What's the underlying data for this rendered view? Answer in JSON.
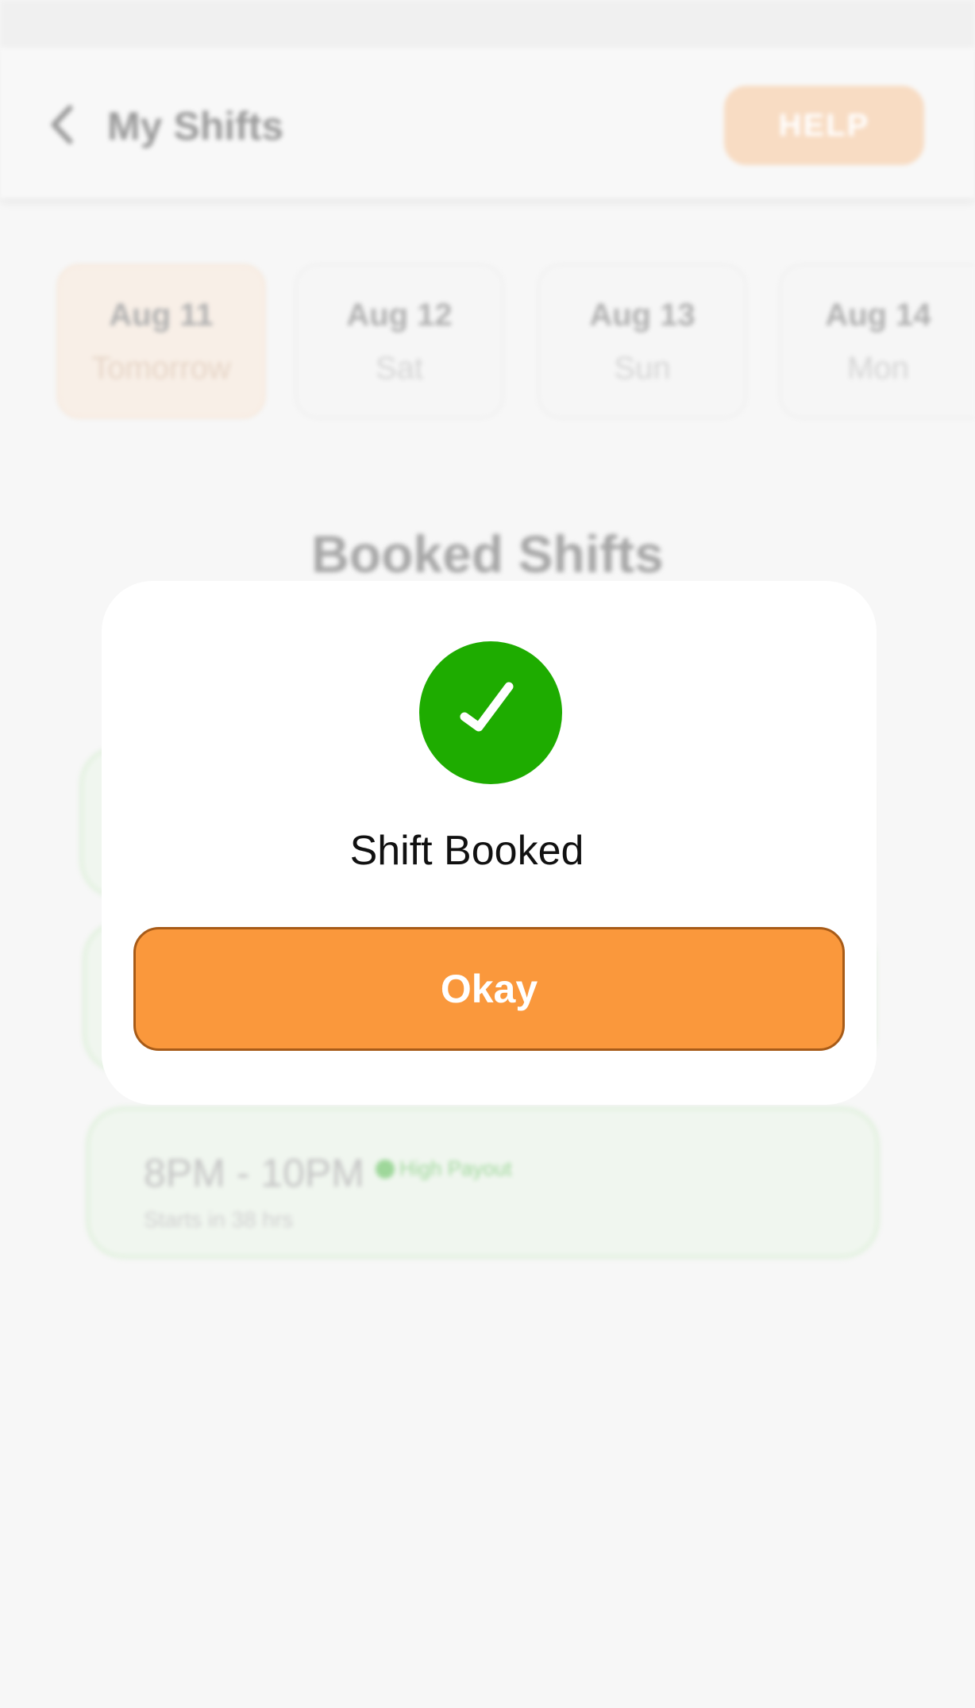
{
  "header": {
    "title": "My Shifts",
    "help_label": "HELP"
  },
  "dates": [
    {
      "date": "Aug 11",
      "sub": "Tomorrow",
      "selected": true
    },
    {
      "date": "Aug 12",
      "sub": "Sat"
    },
    {
      "date": "Aug 13",
      "sub": "Sun"
    },
    {
      "date": "Aug 14",
      "sub": "Mon"
    }
  ],
  "section": {
    "title": "Booked Shifts"
  },
  "shifts": [
    {
      "time": "8PM - 10PM",
      "badge": "High Payout",
      "starts": "Starts in 38 hrs"
    }
  ],
  "modal": {
    "title": "Shift Booked",
    "okay_label": "Okay"
  },
  "colors": {
    "accent": "#fa983c",
    "success": "#1eac00"
  }
}
